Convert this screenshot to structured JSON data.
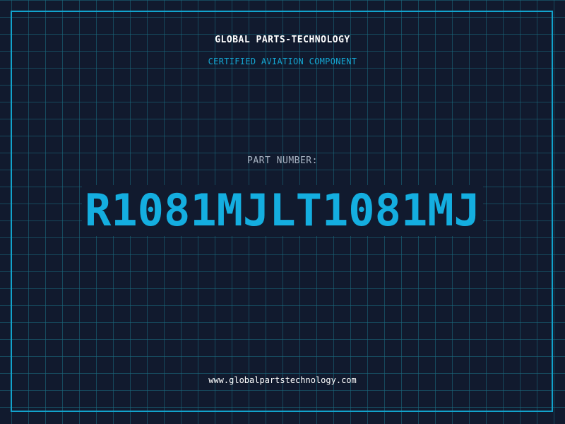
{
  "header": {
    "company": "GLOBAL PARTS-TECHNOLOGY",
    "subtitle": "CERTIFIED AVIATION COMPONENT"
  },
  "part": {
    "label": "PART NUMBER:",
    "number": "R1081MJLT1081MJ"
  },
  "footer": {
    "website": "www.globalpartstechnology.com"
  },
  "colors": {
    "background": "#111a2e",
    "grid": "#1a6e82",
    "accent": "#14aee0",
    "border": "#12a3cc",
    "text": "#ffffff",
    "muted": "#a8b3c2"
  }
}
